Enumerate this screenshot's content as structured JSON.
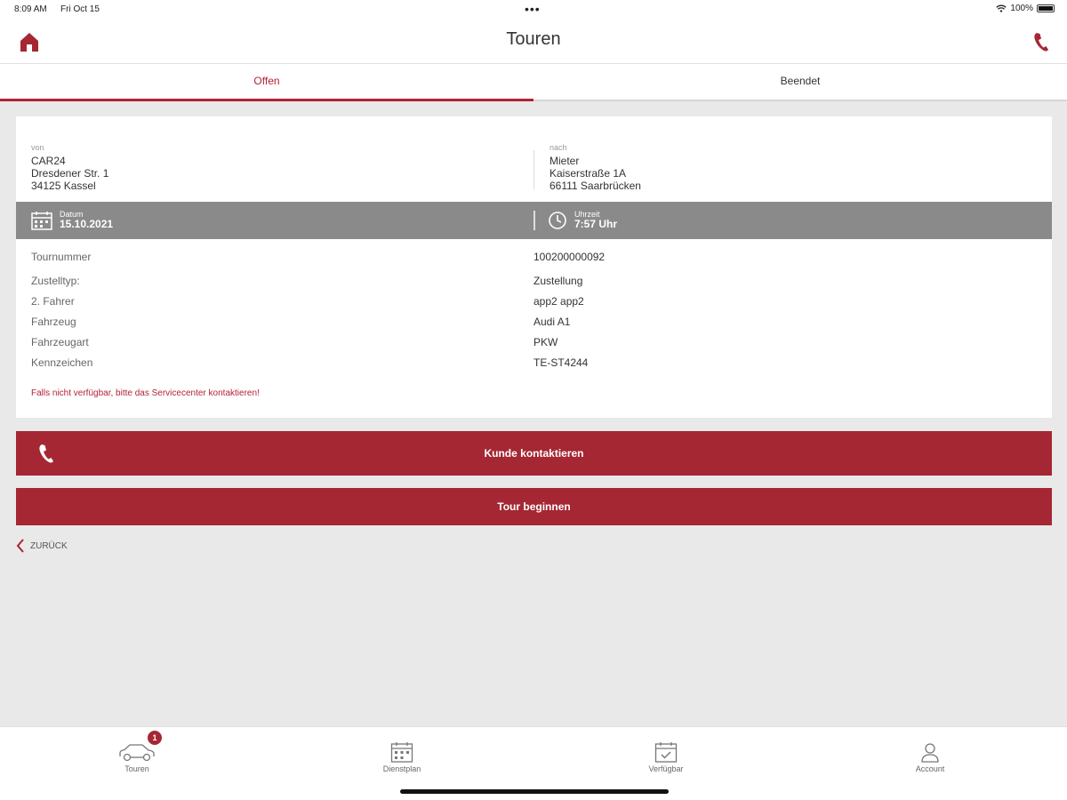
{
  "statusbar": {
    "time": "8:09 AM",
    "date": "Fri Oct 15",
    "dots": "•••",
    "battery": "100%"
  },
  "header": {
    "title": "Touren"
  },
  "tabs": [
    {
      "label": "Offen",
      "active": true
    },
    {
      "label": "Beendet",
      "active": false
    }
  ],
  "tour": {
    "from": {
      "label": "von",
      "line1": "CAR24",
      "line2": "Dresdener Str. 1",
      "line3": "34125 Kassel"
    },
    "to": {
      "label": "nach",
      "line1": "Mieter",
      "line2": "Kaiserstraße 1A",
      "line3": "66111 Saarbrücken"
    },
    "date": {
      "label": "Datum",
      "value": "15.10.2021"
    },
    "time": {
      "label": "Uhrzeit",
      "value": "7:57 Uhr"
    },
    "details": [
      {
        "key": "Tournummer",
        "value": "100200000092"
      },
      {
        "key": "Zustelltyp:",
        "value": "Zustellung"
      },
      {
        "key": "2. Fahrer",
        "value": "app2 app2"
      },
      {
        "key": "Fahrzeug",
        "value": "Audi A1"
      },
      {
        "key": "Fahrzeugart",
        "value": "PKW"
      },
      {
        "key": "Kennzeichen",
        "value": "TE-ST4244"
      }
    ],
    "notice": "Falls nicht verfügbar, bitte das Servicecenter kontaktieren!"
  },
  "actions": {
    "contact_label": "Kunde kontaktieren",
    "start_label": "Tour beginnen",
    "back_label": "ZURÜCK"
  },
  "tabbar": [
    {
      "label": "Touren",
      "icon": "car-icon",
      "badge": "1"
    },
    {
      "label": "Dienstplan",
      "icon": "calendar-icon"
    },
    {
      "label": "Verfügbar",
      "icon": "calendar-check-icon"
    },
    {
      "label": "Account",
      "icon": "user-icon"
    }
  ],
  "colors": {
    "accent": "#a52733",
    "datebar": "#8a8a8a",
    "background": "#e9e9e9"
  }
}
